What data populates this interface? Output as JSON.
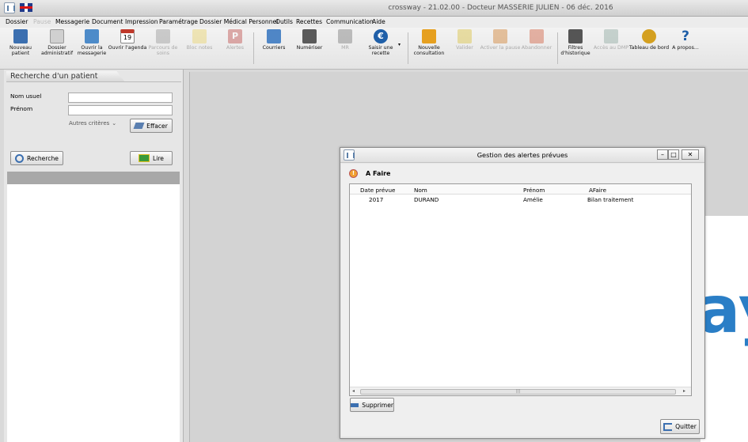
{
  "window": {
    "title": "crossway - 21.02.00 - Docteur MASSERIE JULIEN - 06 déc. 2016"
  },
  "menu": {
    "items": [
      {
        "label": "Dossier",
        "enabled": true
      },
      {
        "label": "Pause",
        "enabled": false
      },
      {
        "label": "Messagerie",
        "enabled": true
      },
      {
        "label": "Document",
        "enabled": true
      },
      {
        "label": "Impression",
        "enabled": true
      },
      {
        "label": "Paramétrage",
        "enabled": true
      },
      {
        "label": "Dossier Médical Personnel",
        "enabled": true
      },
      {
        "label": "Outils",
        "enabled": true
      },
      {
        "label": "Recettes",
        "enabled": true
      },
      {
        "label": "Communication",
        "enabled": true
      },
      {
        "label": "Aide",
        "enabled": true
      }
    ]
  },
  "toolbar": {
    "buttons": [
      {
        "label": "Nouveau patient",
        "icon": "new-patient-icon",
        "color": "#3b6fb0",
        "enabled": true
      },
      {
        "label": "Dossier administratif",
        "icon": "admin-file-icon",
        "color": "#c8c8c8",
        "enabled": true
      },
      {
        "label": "Ouvrir la messagerie",
        "icon": "mail-icon",
        "color": "#4d8bc9",
        "enabled": true
      },
      {
        "label": "Ouvrir l'agenda",
        "icon": "calendar-icon",
        "color": "#c0392b",
        "enabled": true
      },
      {
        "label": "Parcours de soins",
        "icon": "care-path-icon",
        "color": "#999999",
        "enabled": false
      },
      {
        "label": "Bloc notes",
        "icon": "notepad-icon",
        "color": "#e8d36a",
        "enabled": false
      },
      {
        "label": "Alertes",
        "icon": "alert-icon",
        "color": "#c0504d",
        "enabled": false
      },
      {
        "label": "Courriers",
        "icon": "letters-icon",
        "color": "#4f86c6",
        "enabled": true
      },
      {
        "label": "Numériser",
        "icon": "scanner-icon",
        "color": "#5a5a5a",
        "enabled": true
      },
      {
        "label": "MR",
        "icon": "mr-icon",
        "color": "#7a7a7a",
        "enabled": false
      },
      {
        "label": "Saisir une recette",
        "icon": "euro-icon",
        "color": "#1f5fa8",
        "enabled": true
      },
      {
        "label": "Nouvelle consultation",
        "icon": "new-consultation-icon",
        "color": "#e6a020",
        "enabled": true
      },
      {
        "label": "Valider",
        "icon": "validate-icon",
        "color": "#d9c040",
        "enabled": false
      },
      {
        "label": "Activer la pause",
        "icon": "pause-icon",
        "color": "#d08030",
        "enabled": false
      },
      {
        "label": "Abandonner",
        "icon": "abandon-icon",
        "color": "#d06040",
        "enabled": false
      },
      {
        "label": "Filtres d'historique",
        "icon": "filter-icon",
        "color": "#555555",
        "enabled": true
      },
      {
        "label": "Accès au DMP",
        "icon": "dmp-icon",
        "color": "#8fa8a0",
        "enabled": false
      },
      {
        "label": "Tableau de bord",
        "icon": "dashboard-icon",
        "color": "#d4a020",
        "enabled": true
      },
      {
        "label": "A propos...",
        "icon": "help-icon",
        "color": "#1f5fa8",
        "enabled": true
      }
    ]
  },
  "search_panel": {
    "title": "Recherche d'un patient",
    "last_name_label": "Nom usuel",
    "first_name_label": "Prénom",
    "last_name_value": "",
    "first_name_value": "",
    "more_criteria": "Autres critères",
    "clear_button": "Effacer",
    "search_button": "Recherche",
    "read_button": "Lire"
  },
  "dialog": {
    "title": "Gestion des alertes prévues",
    "section_title": "A Faire",
    "columns": [
      "Date prévue",
      "Nom",
      "Prénom",
      "AFaire"
    ],
    "rows": [
      {
        "date": "2017",
        "nom": "DURAND",
        "prenom": "Amélie",
        "afaire": "Bilan traitement"
      }
    ],
    "delete_button": "Supprimer",
    "quit_button": "Quitter"
  },
  "background_logo": {
    "text": "ay",
    "color": "#2a7ec6"
  }
}
